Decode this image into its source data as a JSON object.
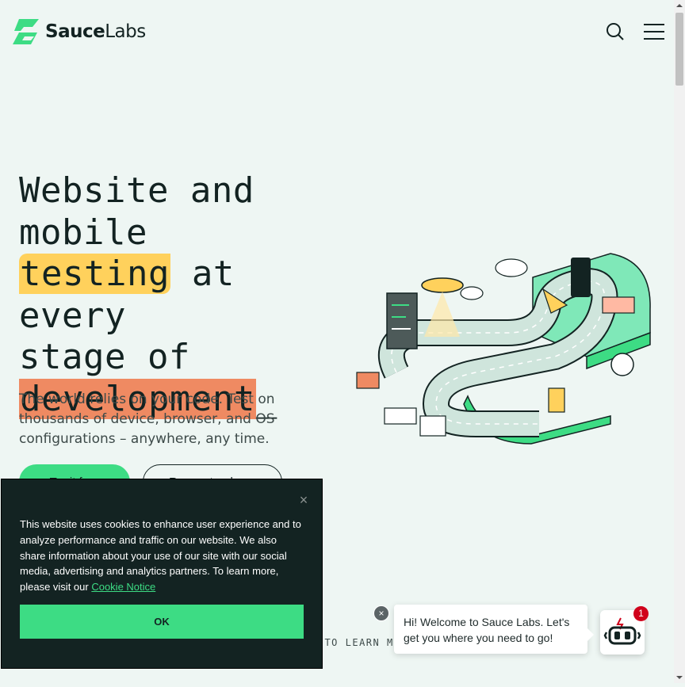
{
  "header": {
    "logo_bold": "Sauce",
    "logo_light": "Labs",
    "search_icon": "search-icon",
    "menu_icon": "hamburger-menu-icon"
  },
  "hero": {
    "title_line1": "Website and",
    "title_line2": "mobile",
    "title_highlight1": "testing",
    "title_after_highlight1": " at every",
    "title_line4": "stage of",
    "title_highlight2": "development",
    "title_cursor": "_",
    "subtitle": "The world relies on your code. Test on thousands of device, browser, and OS configurations – anywhere, any time.",
    "primary_cta": "Try it free",
    "secondary_cta": "Request a demo"
  },
  "scroll_hint": "L TO LEARN M",
  "cookie_banner": {
    "text": "This website uses cookies to enhance user experience and to analyze performance and traffic on our website. We also share information about your use of our site with our social media, advertising and analytics partners. To learn more, please visit our ",
    "link_text": "Cookie Notice",
    "ok_label": "OK",
    "close_label": "×"
  },
  "chat": {
    "message": "Hi! Welcome to Sauce Labs. Let's get you where you need to go!",
    "badge_count": "1",
    "close_label": "×",
    "launcher_icon": "robot-icon"
  },
  "colors": {
    "background": "#eef6f3",
    "accent_green": "#3ddc84",
    "highlight_yellow": "#ffd15c",
    "highlight_orange": "#ef8a62",
    "dark": "#132322"
  }
}
